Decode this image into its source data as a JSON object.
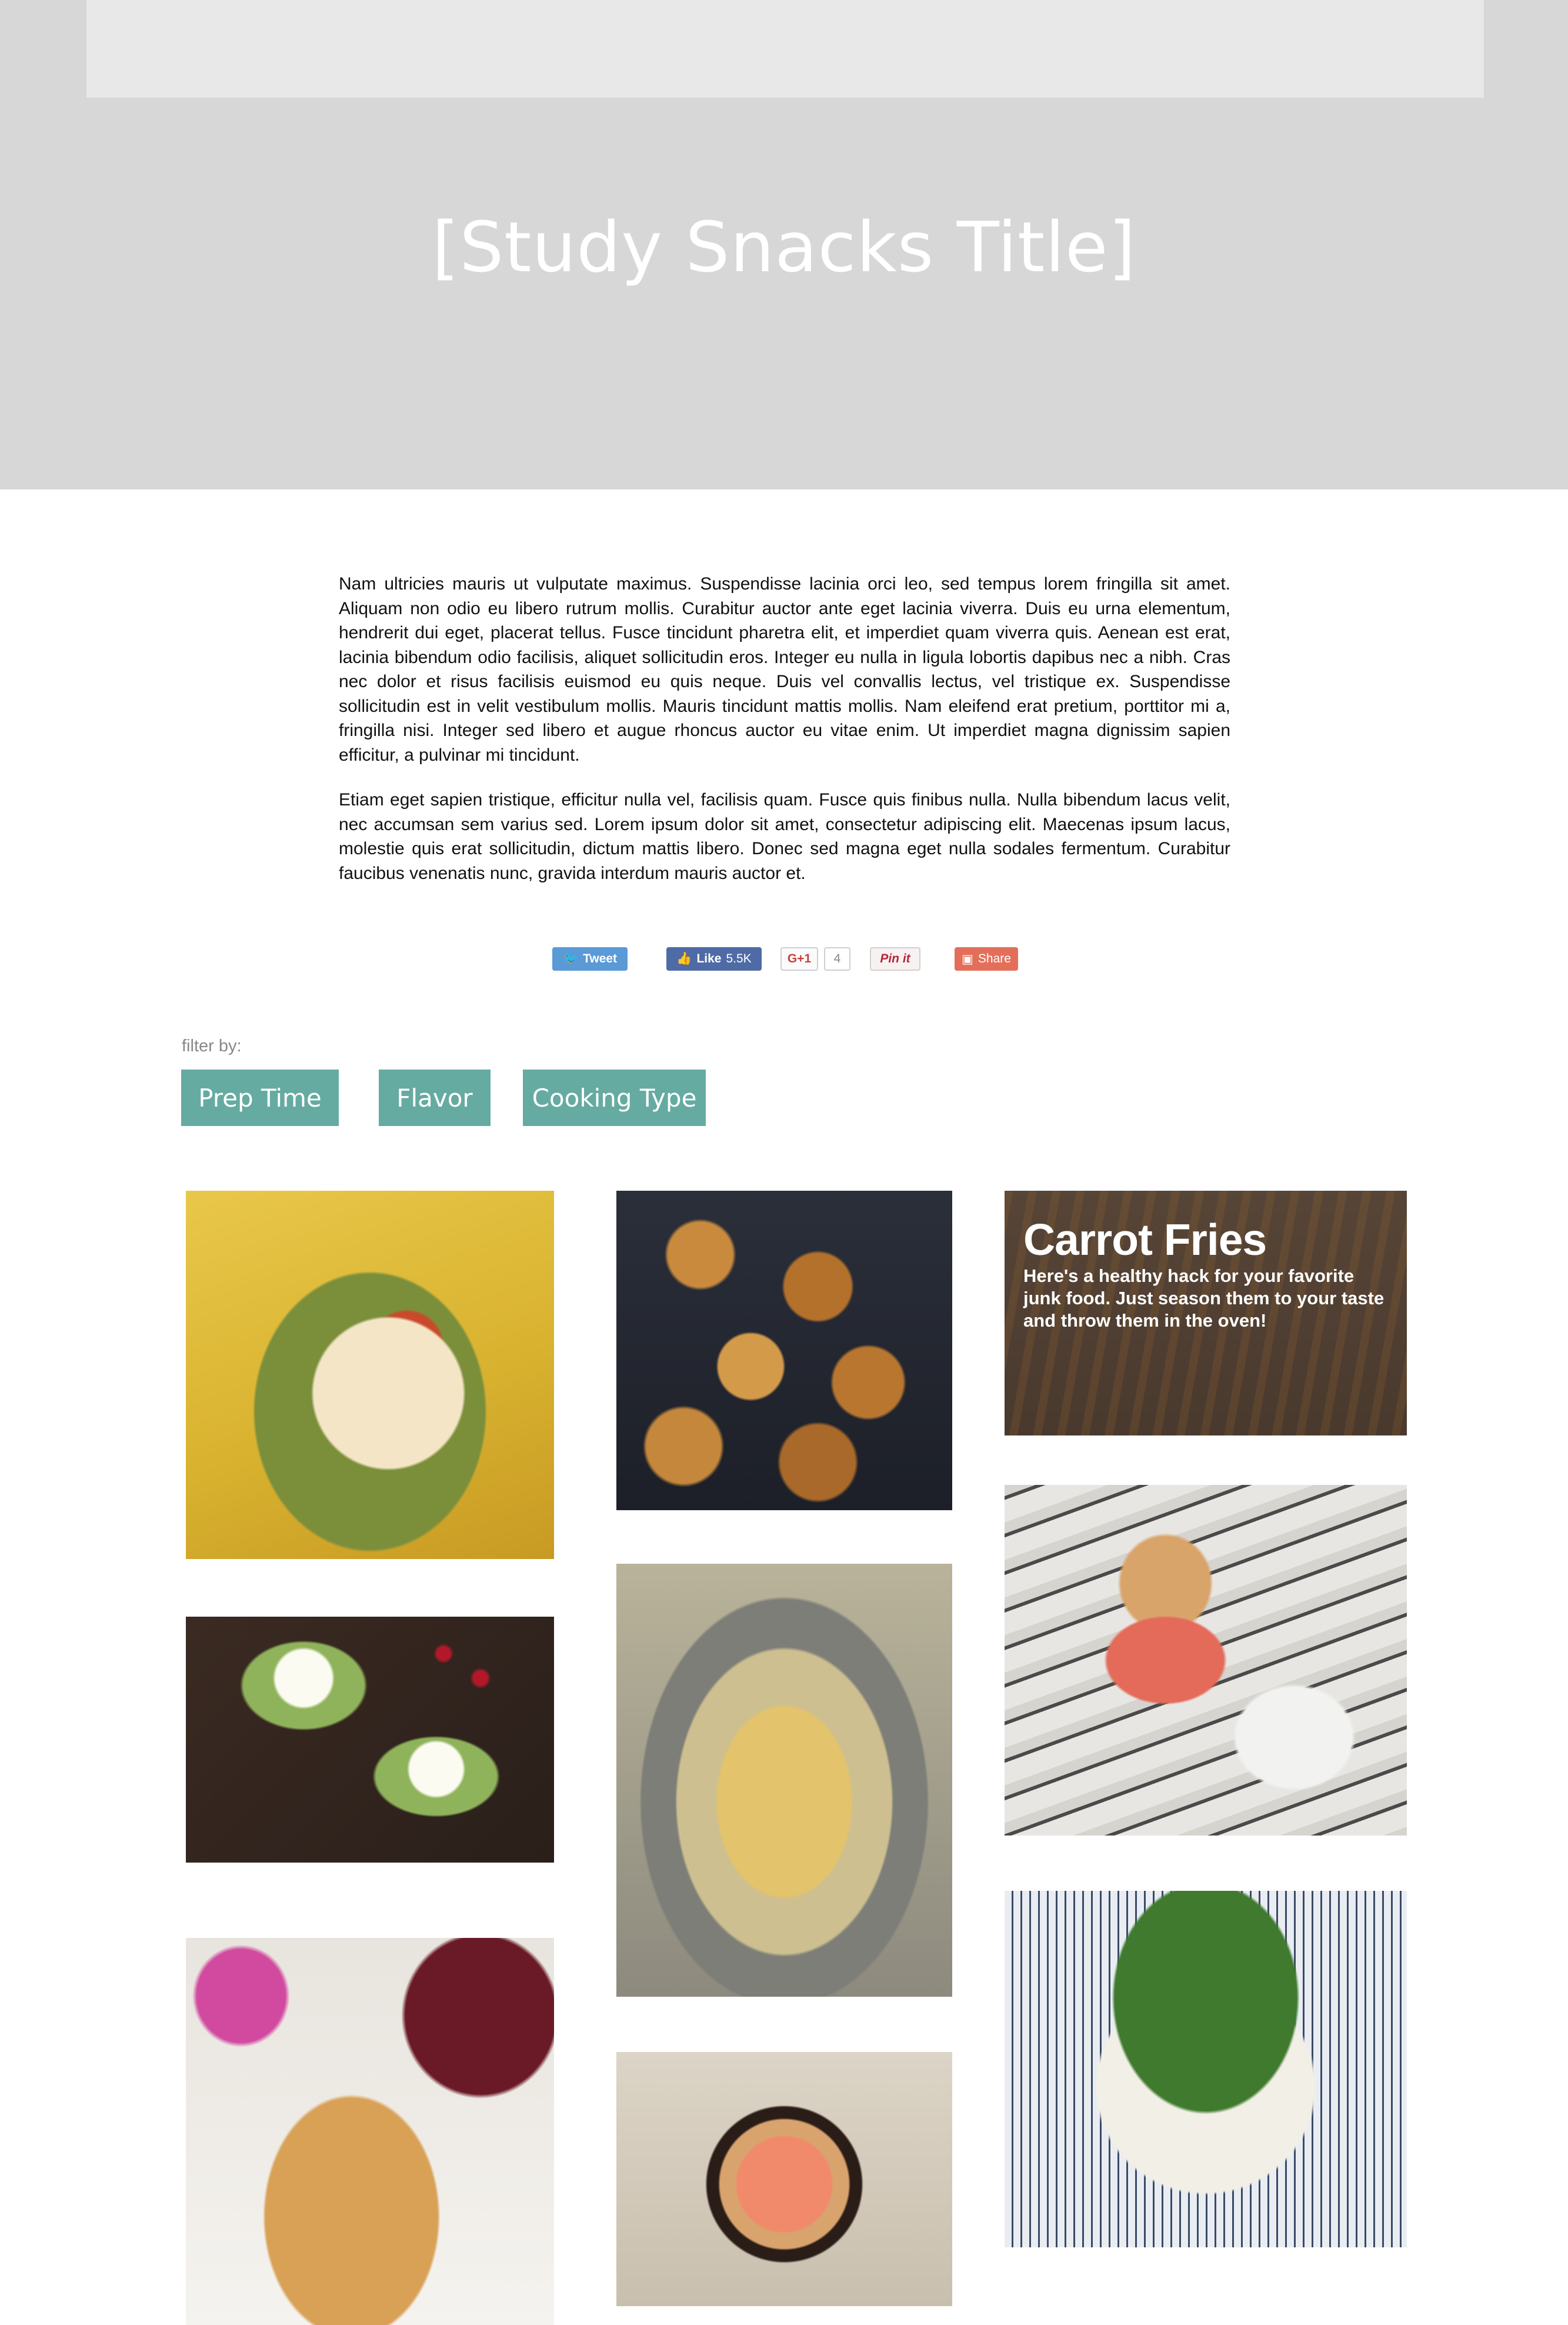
{
  "hero": {
    "title": "[Study Snacks Title]"
  },
  "article": {
    "paragraphs": [
      "Nam ultricies mauris ut vulputate maximus. Suspendisse lacinia orci leo, sed tempus lorem fringilla sit amet. Aliquam non odio eu libero rutrum mollis. Curabitur auctor ante eget lacinia viverra. Duis eu urna elementum, hendrerit dui eget, placerat tellus. Fusce tincidunt pharetra elit, et imperdiet quam viverra quis. Aenean est erat, lacinia bibendum odio facilisis, aliquet sollicitudin eros. Integer eu nulla in ligula lobortis dapibus nec a nibh. Cras nec dolor et risus facilisis euismod eu quis neque. Duis vel convallis lectus, vel tristique ex. Suspendisse sollicitudin est in velit vestibulum mollis. Mauris tincidunt mattis mollis. Nam eleifend erat pretium, porttitor mi a, fringilla nisi. Integer sed libero et augue rhoncus auctor eu vitae enim. Ut imperdiet magna dignissim sapien efficitur, a pulvinar mi tincidunt.",
      "Etiam eget sapien tristique, efficitur nulla vel, facilisis quam. Fusce quis finibus nulla. Nulla bibendum lacus velit, nec accumsan sem varius sed. Lorem ipsum dolor sit amet, consectetur adipiscing elit. Maecenas ipsum lacus, molestie quis erat sollicitudin, dictum mattis libero. Donec sed magna eget nulla sodales fermentum. Curabitur faucibus venenatis nunc, gravida interdum mauris auctor et."
    ]
  },
  "social": {
    "tweet": "Tweet",
    "like": "Like",
    "like_count": "5.5K",
    "gplus": "G+1",
    "gplus_count": "4",
    "pinit": "Pin it",
    "share": "Share"
  },
  "filters": {
    "label": "filter by:",
    "buttons": [
      "Prep Time",
      "Flavor",
      "Cooking Type"
    ],
    "color": "#66aba2"
  },
  "tiles": {
    "carrot_fries": {
      "title": "Carrot Fries",
      "description": "Here's a healthy hack for your favorite junk food. Just season them to your taste and throw them in the oven!"
    }
  },
  "colors": {
    "hero_bg": "#d7d7d7",
    "topbar_bg": "#e8e8e8",
    "accent": "#66aba2"
  }
}
